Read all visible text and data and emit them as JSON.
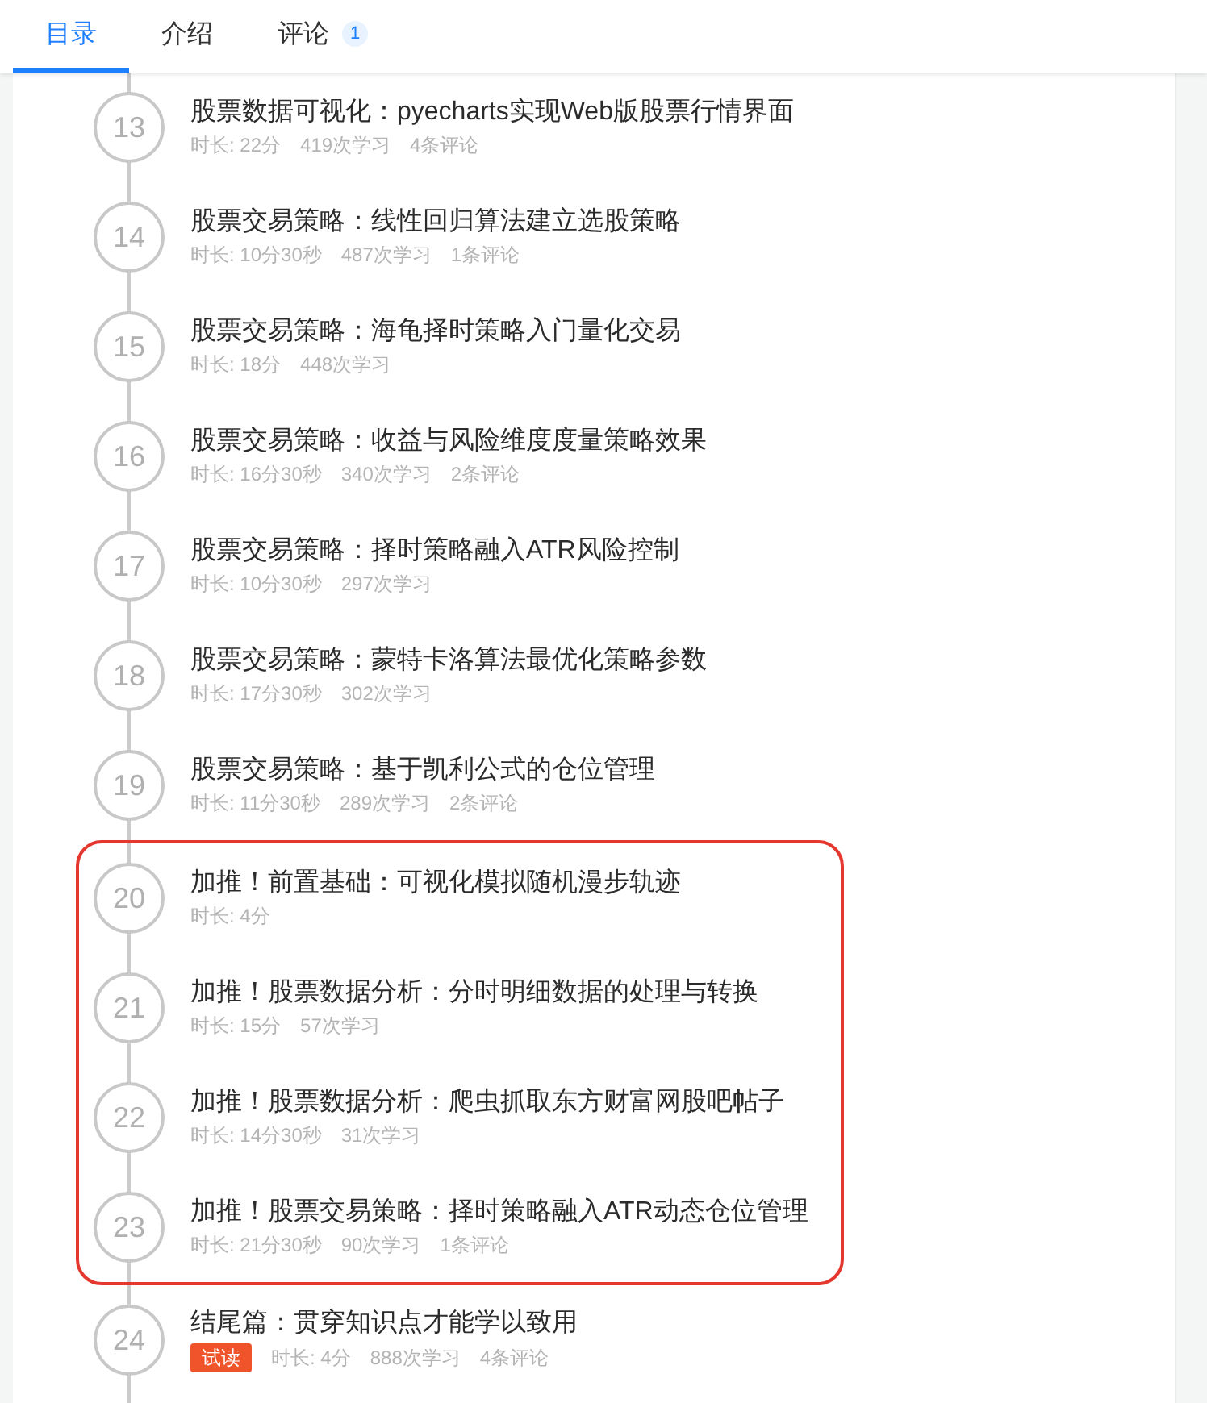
{
  "tabs": [
    {
      "label": "目录",
      "selected": true
    },
    {
      "label": "介绍",
      "selected": false
    },
    {
      "label": "评论",
      "selected": false,
      "count": "1"
    }
  ],
  "lessons": [
    {
      "number": "13",
      "title": "股票数据可视化：pyecharts实现Web版股票行情界面",
      "duration": "时长: 22分",
      "views": "419次学习",
      "comments": "4条评论",
      "highlighted": false
    },
    {
      "number": "14",
      "title": "股票交易策略：线性回归算法建立选股策略",
      "duration": "时长: 10分30秒",
      "views": "487次学习",
      "comments": "1条评论",
      "highlighted": false
    },
    {
      "number": "15",
      "title": "股票交易策略：海龟择时策略入门量化交易",
      "duration": "时长: 18分",
      "views": "448次学习",
      "highlighted": false
    },
    {
      "number": "16",
      "title": "股票交易策略：收益与风险维度度量策略效果",
      "duration": "时长: 16分30秒",
      "views": "340次学习",
      "comments": "2条评论",
      "highlighted": false
    },
    {
      "number": "17",
      "title": "股票交易策略：择时策略融入ATR风险控制",
      "duration": "时长: 10分30秒",
      "views": "297次学习",
      "highlighted": false
    },
    {
      "number": "18",
      "title": "股票交易策略：蒙特卡洛算法最优化策略参数",
      "duration": "时长: 17分30秒",
      "views": "302次学习",
      "highlighted": false
    },
    {
      "number": "19",
      "title": "股票交易策略：基于凯利公式的仓位管理",
      "duration": "时长: 11分30秒",
      "views": "289次学习",
      "comments": "2条评论",
      "highlighted": false
    },
    {
      "number": "20",
      "title": "加推！前置基础：可视化模拟随机漫步轨迹",
      "duration": "时长: 4分",
      "highlighted": true
    },
    {
      "number": "21",
      "title": "加推！股票数据分析：分时明细数据的处理与转换",
      "duration": "时长: 15分",
      "views": "57次学习",
      "highlighted": true
    },
    {
      "number": "22",
      "title": "加推！股票数据分析：爬虫抓取东方财富网股吧帖子",
      "duration": "时长: 14分30秒",
      "views": "31次学习",
      "highlighted": true
    },
    {
      "number": "23",
      "title": "加推！股票交易策略：择时策略融入ATR动态仓位管理",
      "duration": "时长: 21分30秒",
      "views": "90次学习",
      "comments": "1条评论",
      "highlighted": true
    },
    {
      "number": "24",
      "title": "结尾篇：贯穿知识点才能学以致用",
      "badge": "试读",
      "duration": "时长: 4分",
      "views": "888次学习",
      "comments": "4条评论",
      "highlighted": false
    }
  ]
}
